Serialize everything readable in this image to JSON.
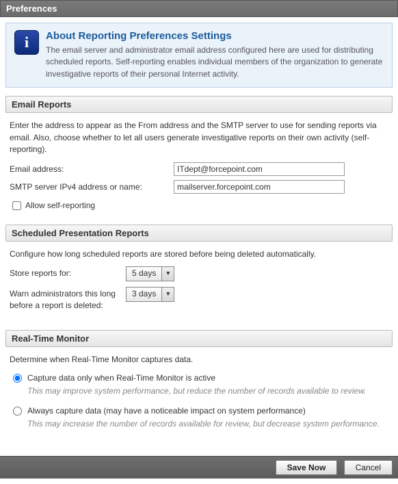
{
  "window": {
    "title": "Preferences"
  },
  "about": {
    "title": "About Reporting Preferences Settings",
    "body": "The email server and administrator email address configured here are used for distributing scheduled reports. Self-reporting enables individual members of the organization to generate investigative reports of their personal Internet activity."
  },
  "email_reports": {
    "header": "Email Reports",
    "intro": "Enter the address to appear as the From address and the SMTP server to use for sending reports via email. Also, choose whether to let all users generate investigative reports on their own activity (self-reporting).",
    "email_label": "Email address:",
    "email_value": "ITdept@forcepoint.com",
    "smtp_label": "SMTP server IPv4 address or name:",
    "smtp_value": "mailserver.forcepoint.com",
    "selfreport_label": "Allow self-reporting"
  },
  "scheduled": {
    "header": "Scheduled Presentation Reports",
    "intro": "Configure how long scheduled reports are stored before being deleted automatically.",
    "store_label": "Store reports for:",
    "store_value": "5 days",
    "warn_label": "Warn administrators this long before a report is deleted:",
    "warn_value": "3 days"
  },
  "realtime": {
    "header": "Real-Time Monitor",
    "intro": "Determine when Real-Time Monitor captures data.",
    "opt1_label": "Capture data only when Real-Time Monitor is active",
    "opt1_desc": "This may improve system performance, but reduce the number of records available to review.",
    "opt2_label": "Always capture data (may have a noticeable impact on system performance)",
    "opt2_desc": "This may increase the number of records available for review, but decrease system performance."
  },
  "buttons": {
    "save": "Save Now",
    "cancel": "Cancel"
  }
}
